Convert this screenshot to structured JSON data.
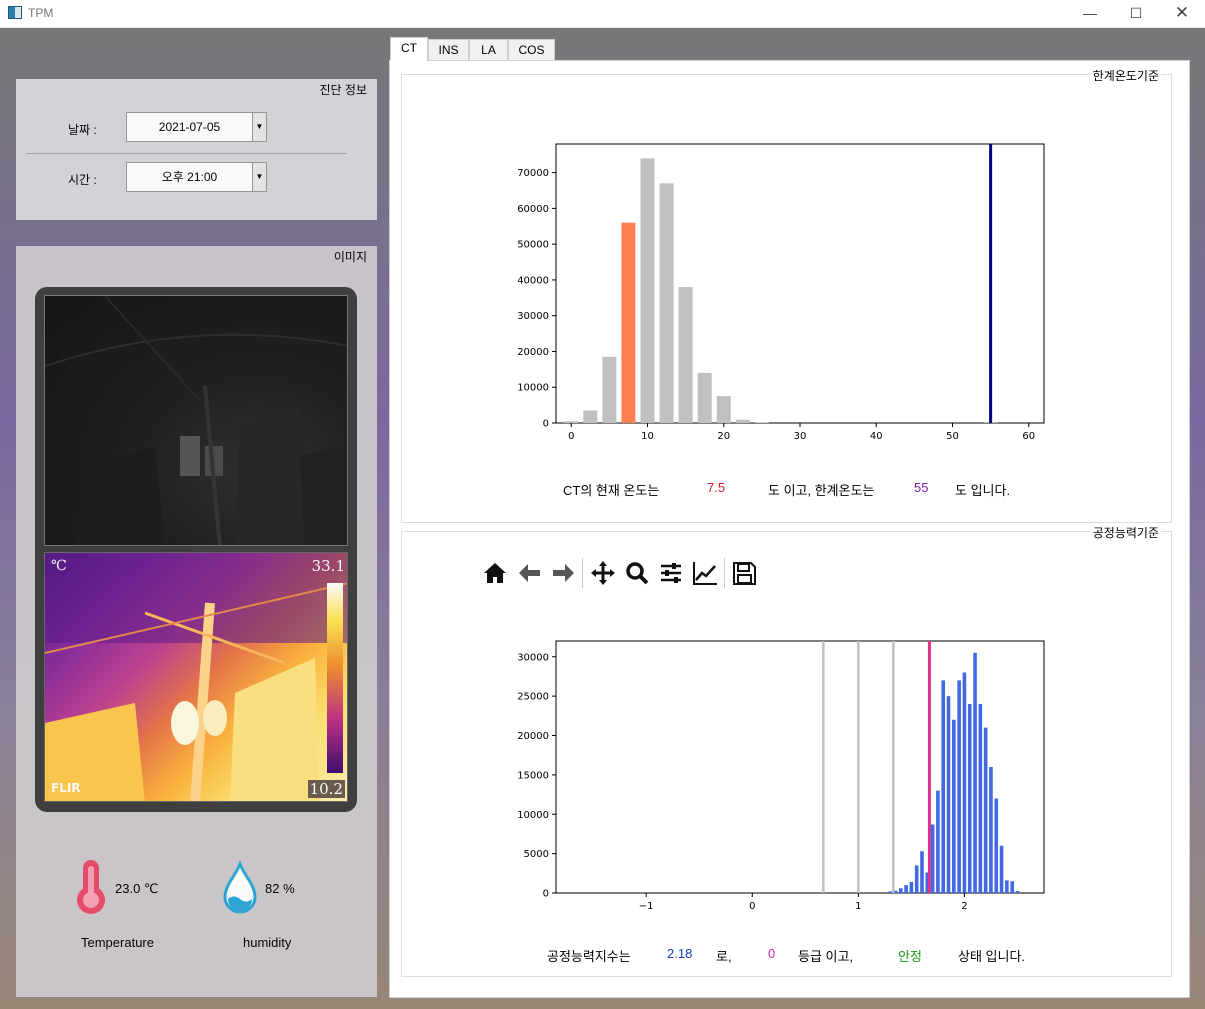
{
  "window": {
    "title": "TPM",
    "minimize": "—",
    "maximize": "☐",
    "close": "✕"
  },
  "tabs": [
    "CT",
    "INS",
    "LA",
    "COS"
  ],
  "diagnosis": {
    "title": "진단 정보",
    "date_label": "날짜 :",
    "date_value": "2021-07-05",
    "time_label": "시간 :",
    "time_value": "오후 21:00"
  },
  "image_group": {
    "title": "이미지",
    "ir_max": "33.1",
    "ir_min": "10.2",
    "ir_unit": "℃",
    "ir_logo": "FLIR"
  },
  "sensors": {
    "temperature_value": "23.0 ℃",
    "temperature_label": "Temperature",
    "humidity_value": "82 %",
    "humidity_label": "humidity"
  },
  "threshold_frame": {
    "title": "한계온도기준",
    "text1": "CT의 현재 온도는",
    "current_temp": "7.5",
    "text2": "도 이고, 한계온도는",
    "limit_temp": "55",
    "text3": "도 입니다."
  },
  "capability_frame": {
    "title": "공정능력기준",
    "text1": "공정능력지수는",
    "index": "2.18",
    "text2": "로,",
    "grade": "0",
    "text3": "등급 이고,",
    "state": "안정",
    "text4": "상태 입니다."
  },
  "toolbar": [
    "home-icon",
    "back-icon",
    "forward-icon",
    "pan-icon",
    "zoom-icon",
    "configure-icon",
    "edit-axis-icon",
    "save-icon"
  ],
  "colors": {
    "highlight_bar": "#ff7f50",
    "normal_bar": "#c0c0c0",
    "limit_line": "#000080",
    "hist_bar": "#4169e1",
    "marker_line": "#e0308c",
    "ref_line": "#c0c0c0"
  },
  "chart_data": [
    {
      "type": "bar",
      "x": [
        0,
        2.5,
        5,
        7.5,
        10,
        12.5,
        15,
        17.5,
        20,
        22.5,
        25,
        27.5,
        30,
        32.5,
        35,
        37.5,
        40,
        42.5,
        45,
        47.5,
        50,
        52.5,
        55,
        57.5,
        60
      ],
      "values": [
        500,
        3500,
        18500,
        56000,
        74000,
        67000,
        38000,
        14000,
        7500,
        900,
        200,
        0,
        0,
        0,
        0,
        0,
        0,
        0,
        0,
        0,
        0,
        0,
        300,
        0,
        0
      ],
      "highlight_x": 7.5,
      "vline_x": 55,
      "xlim": [
        -2,
        62
      ],
      "ylim": [
        0,
        78000
      ],
      "xticks": [
        0,
        10,
        20,
        30,
        40,
        50,
        60
      ],
      "yticks": [
        0,
        10000,
        20000,
        30000,
        40000,
        50000,
        60000,
        70000
      ],
      "title": "",
      "xlabel": "",
      "ylabel": ""
    },
    {
      "type": "bar",
      "x": [
        1.3,
        1.35,
        1.4,
        1.45,
        1.5,
        1.55,
        1.6,
        1.65,
        1.7,
        1.75,
        1.8,
        1.85,
        1.9,
        1.95,
        2.0,
        2.05,
        2.1,
        2.15,
        2.2,
        2.25,
        2.3,
        2.35,
        2.4,
        2.45,
        2.5
      ],
      "values": [
        200,
        300,
        600,
        1000,
        1400,
        3500,
        5300,
        2600,
        8700,
        13000,
        27000,
        25000,
        22000,
        27000,
        28000,
        24000,
        30500,
        24000,
        21000,
        16000,
        12000,
        6000,
        1600,
        1500,
        250
      ],
      "vlines_gray": [
        0.67,
        1.0,
        1.33
      ],
      "vline_marker": 1.67,
      "xlim": [
        -1.85,
        2.75
      ],
      "ylim": [
        0,
        32000
      ],
      "xticks": [
        -1,
        0,
        1,
        2
      ],
      "yticks": [
        0,
        5000,
        10000,
        15000,
        20000,
        25000,
        30000
      ],
      "title": "",
      "xlabel": "",
      "ylabel": ""
    }
  ]
}
